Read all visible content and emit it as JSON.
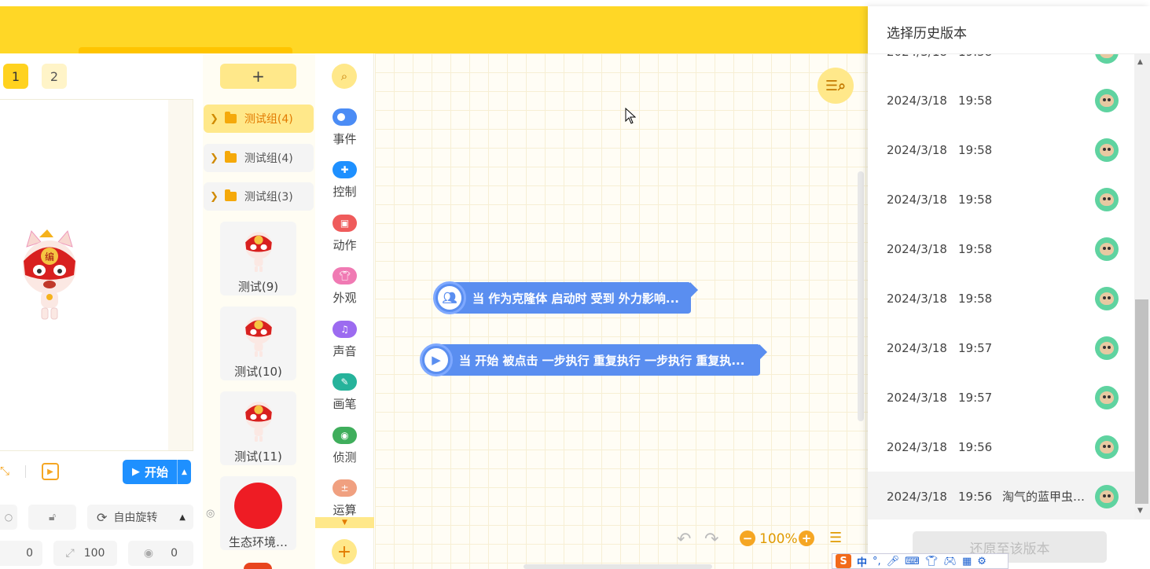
{
  "stage": {
    "pages": [
      "1",
      "2"
    ],
    "start_label": "开始",
    "rotation_label": "自由旋转",
    "x_value": "0",
    "size_value": "100",
    "direction_value": "0"
  },
  "sprites": {
    "add_label": "+",
    "groups": [
      {
        "label": "测试组(4)",
        "active": true
      },
      {
        "label": "测试组(4)",
        "active": false
      },
      {
        "label": "测试组(3)",
        "active": false
      }
    ],
    "cards": [
      {
        "label": "测试(9)"
      },
      {
        "label": "测试(10)"
      },
      {
        "label": "测试(11)"
      },
      {
        "label": "生态环境…"
      }
    ]
  },
  "categories": [
    {
      "label": "事件",
      "color": "#4b8cf5"
    },
    {
      "label": "控制",
      "color": "#1e90ff"
    },
    {
      "label": "动作",
      "color": "#ef5b5b"
    },
    {
      "label": "外观",
      "color": "#f07ab3"
    },
    {
      "label": "声音",
      "color": "#9c6bf0"
    },
    {
      "label": "画笔",
      "color": "#26b39b"
    },
    {
      "label": "侦测",
      "color": "#3fae5c"
    },
    {
      "label": "运算",
      "color": "#f0a080"
    }
  ],
  "workspace": {
    "blocks": [
      {
        "text": "当 作为克隆体 启动时 受到 外力影响..."
      },
      {
        "text": "当 开始 被点击 一步执行 重复执行 一步执行 重复执..."
      }
    ],
    "zoom": "100%"
  },
  "history": {
    "title": "选择历史版本",
    "rows": [
      {
        "date": "2024/3/18",
        "time": "19:58",
        "name": ""
      },
      {
        "date": "2024/3/18",
        "time": "19:58",
        "name": ""
      },
      {
        "date": "2024/3/18",
        "time": "19:58",
        "name": ""
      },
      {
        "date": "2024/3/18",
        "time": "19:58",
        "name": ""
      },
      {
        "date": "2024/3/18",
        "time": "19:58",
        "name": ""
      },
      {
        "date": "2024/3/18",
        "time": "19:57",
        "name": ""
      },
      {
        "date": "2024/3/18",
        "time": "19:57",
        "name": ""
      },
      {
        "date": "2024/3/18",
        "time": "19:56",
        "name": ""
      },
      {
        "date": "2024/3/18",
        "time": "19:56",
        "name": "淘气的蓝甲虫…"
      }
    ],
    "restore_label": "还原至该版本"
  },
  "ime": {
    "logo": "S",
    "mode": "中"
  },
  "colors": {
    "accent": "#ffd726",
    "block": "#5a8ef0",
    "start": "#1e90ff"
  }
}
